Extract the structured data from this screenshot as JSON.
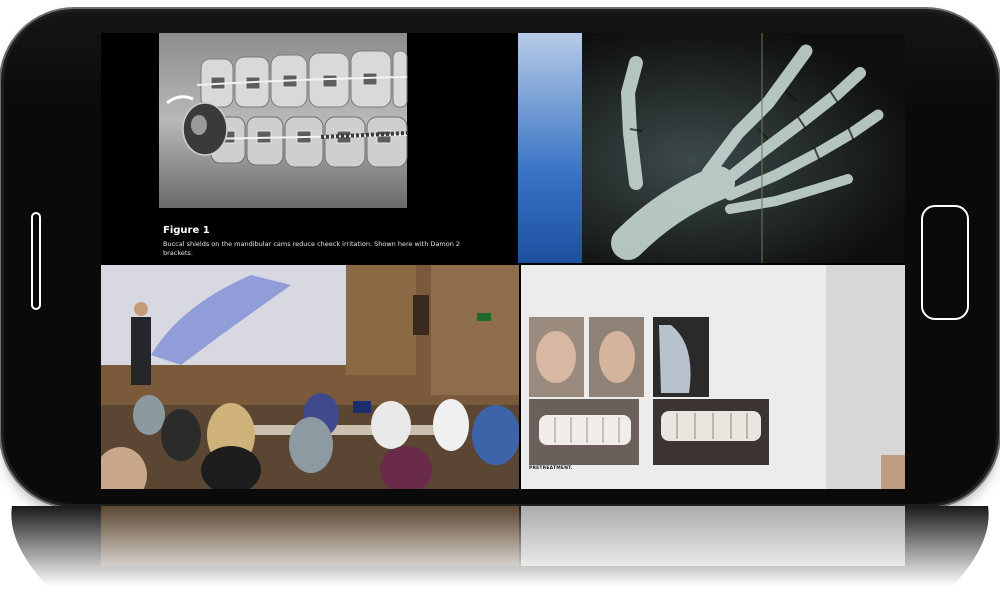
{
  "device": {
    "type": "smartphone-landscape",
    "colors": {
      "body": "#0a0a0a",
      "button_outline": "#ffffff",
      "screen": "#000000"
    }
  },
  "panels": {
    "top_left": {
      "content": "orthodontic-braces-photo",
      "figure_title": "Figure 1",
      "figure_caption": "Buccal shields on the mandibular cams reduce cheeck irritation. Shown here with Damon 2 brackets."
    },
    "top_right": {
      "content": "hand-xray"
    },
    "bottom_left": {
      "content": "lecture-classroom-photo"
    },
    "bottom_right": {
      "content": "orthodontic-case-slide",
      "label": "PRETREATMENT."
    }
  }
}
